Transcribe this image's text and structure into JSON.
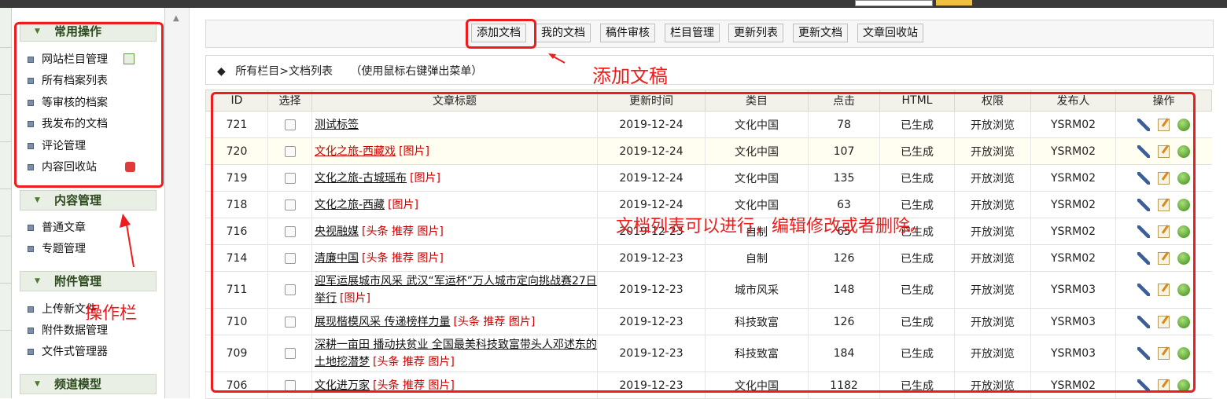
{
  "toolbar": {
    "buttons": [
      "添加文档",
      "我的文档",
      "稿件审核",
      "栏目管理",
      "更新列表",
      "更新文档",
      "文章回收站"
    ]
  },
  "sidebar": {
    "groups": [
      {
        "title": "常用操作",
        "items": [
          "网站栏目管理",
          "所有档案列表",
          "等审核的档案",
          "我发布的文档",
          "评论管理",
          "内容回收站"
        ]
      },
      {
        "title": "内容管理",
        "items": [
          "普通文章",
          "专题管理"
        ]
      },
      {
        "title": "附件管理",
        "items": [
          "上传新文件",
          "附件数据管理",
          "文件式管理器"
        ]
      },
      {
        "title": "频道模型",
        "items": []
      }
    ]
  },
  "listbar": {
    "bullet": "◆",
    "path": "所有栏目>文档列表",
    "hint": "（使用鼠标右键弹出菜单）"
  },
  "table": {
    "columns": [
      "ID",
      "选择",
      "文章标题",
      "更新时间",
      "类目",
      "点击",
      "HTML",
      "权限",
      "发布人",
      "操作"
    ],
    "rows": [
      {
        "id": "721",
        "title": "测试标签",
        "tags": "",
        "date": "2019-12-24",
        "category": "文化中国",
        "clicks": "78",
        "html": "已生成",
        "perm": "开放浏览",
        "author": "YSRM02"
      },
      {
        "id": "720",
        "title": "文化之旅-西藏戏",
        "tags": "[图片]",
        "date": "2019-12-24",
        "category": "文化中国",
        "clicks": "107",
        "html": "已生成",
        "perm": "开放浏览",
        "author": "YSRM02"
      },
      {
        "id": "719",
        "title": "文化之旅-古城瑶布",
        "tags": "[图片]",
        "date": "2019-12-24",
        "category": "文化中国",
        "clicks": "135",
        "html": "已生成",
        "perm": "开放浏览",
        "author": "YSRM02"
      },
      {
        "id": "718",
        "title": "文化之旅-西藏",
        "tags": "[图片]",
        "date": "2019-12-24",
        "category": "文化中国",
        "clicks": "63",
        "html": "已生成",
        "perm": "开放浏览",
        "author": "YSRM02"
      },
      {
        "id": "716",
        "title": "央视融媒",
        "tags": "[头条 推荐 图片]",
        "date": "2019-12-23",
        "category": "自制",
        "clicks": "65",
        "html": "已生成",
        "perm": "开放浏览",
        "author": "YSRM02"
      },
      {
        "id": "714",
        "title": "清廉中国",
        "tags": "[头条 推荐 图片]",
        "date": "2019-12-23",
        "category": "自制",
        "clicks": "126",
        "html": "已生成",
        "perm": "开放浏览",
        "author": "YSRM02"
      },
      {
        "id": "711",
        "title": "迎军运展城市风采 武汉“军运杯”万人城市定向挑战赛27日举行",
        "tags": "[图片]",
        "date": "2019-12-23",
        "category": "城市风采",
        "clicks": "148",
        "html": "已生成",
        "perm": "开放浏览",
        "author": "YSRM03"
      },
      {
        "id": "710",
        "title": "展现楷模风采 传递榜样力量",
        "tags": "[头条 推荐 图片]",
        "date": "2019-12-23",
        "category": "科技致富",
        "clicks": "126",
        "html": "已生成",
        "perm": "开放浏览",
        "author": "YSRM03"
      },
      {
        "id": "709",
        "title": "深耕一亩田 播动扶贫业 全国最美科技致富带头人邓述东的土地挖潜梦",
        "tags": "[头条 推荐 图片]",
        "date": "2019-12-23",
        "category": "科技致富",
        "clicks": "184",
        "html": "已生成",
        "perm": "开放浏览",
        "author": "YSRM03"
      },
      {
        "id": "706",
        "title": "文化进万家",
        "tags": "[头条 推荐 图片]",
        "date": "2019-12-23",
        "category": "文化中国",
        "clicks": "1182",
        "html": "已生成",
        "perm": "开放浏览",
        "author": "YSRM02"
      }
    ]
  },
  "annotations": {
    "add_doc": "添加文稿",
    "list_note": "文档列表可以进行，编辑修改或者删除。",
    "sidebar_note": "操作栏"
  },
  "colors": {
    "annotation": "#ee1c1c",
    "tag": "#cc0000"
  }
}
